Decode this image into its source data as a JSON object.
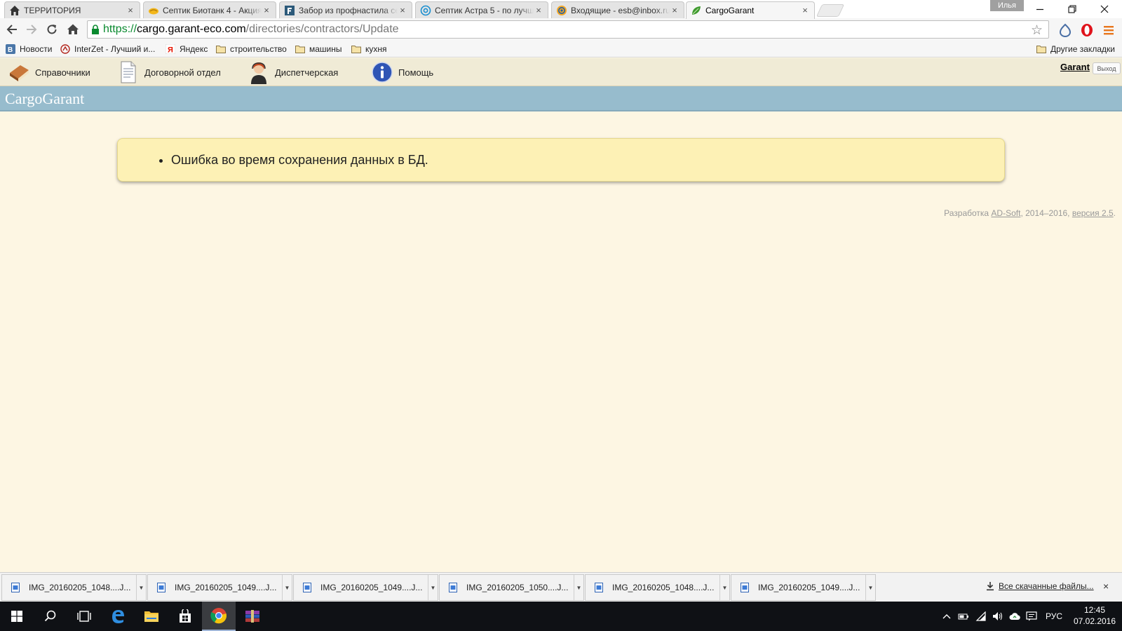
{
  "browser": {
    "tabs": [
      {
        "title": "ТЕРРИТОРИЯ",
        "icon": "home-icon",
        "close": "×"
      },
      {
        "title": "Септик Биотанк 4 - Акция",
        "icon": "handshake-icon",
        "close": "×"
      },
      {
        "title": "Забор из профнастила се",
        "icon": "f-logo-icon",
        "close": "×"
      },
      {
        "title": "Септик Астра 5 - по лучш",
        "icon": "at-icon",
        "close": "×"
      },
      {
        "title": "Входящие - esb@inbox.ru",
        "icon": "at-icon",
        "close": "×"
      },
      {
        "title": "CargoGarant",
        "icon": "leaf-icon",
        "close": "×"
      }
    ],
    "profile_name": "Илья",
    "address": {
      "scheme": "https://",
      "host": "cargo.garant-eco.com",
      "path": "/directories/contractors/Update"
    },
    "bookmarks": [
      {
        "label": "Новости",
        "icon": "vk-icon"
      },
      {
        "label": "InterZet - Лучший и...",
        "icon": "interzet-icon"
      },
      {
        "label": "Яндекс",
        "icon": "yandex-icon"
      },
      {
        "label": "строительство",
        "icon": "folder-icon"
      },
      {
        "label": "машины",
        "icon": "folder-icon"
      },
      {
        "label": "кухня",
        "icon": "folder-icon"
      }
    ],
    "other_bookmarks": "Другие закладки"
  },
  "app": {
    "menu": [
      {
        "label": "Справочники",
        "icon": "book-icon"
      },
      {
        "label": "Договорной отдел",
        "icon": "document-icon"
      },
      {
        "label": "Диспетчерская",
        "icon": "dispatcher-icon"
      },
      {
        "label": "Помощь",
        "icon": "info-icon"
      }
    ],
    "user": "Garant",
    "logout": "Выход",
    "brand": "CargoGarant"
  },
  "main": {
    "errors": [
      "Ошибка во время сохранения данных в БД."
    ],
    "footer": {
      "prefix": "Разработка ",
      "company": "AD-Soft",
      "years": ", 2014–2016, ",
      "version": "версия 2.5",
      "suffix": "."
    }
  },
  "downloads": {
    "items": [
      "IMG_20160205_1048....J...",
      "IMG_20160205_1049....J...",
      "IMG_20160205_1049....J...",
      "IMG_20160205_1050....J...",
      "IMG_20160205_1048....J...",
      "IMG_20160205_1049....J..."
    ],
    "all_label": "Все скачанные файлы...",
    "close": "×"
  },
  "taskbar": {
    "language": "РУС",
    "time": "12:45",
    "date": "07.02.2016"
  },
  "colors": {
    "brand_bar": "#97bccd",
    "menu_bar": "#f0ebd6",
    "content_bg": "#fdf6e3",
    "alert_bg": "#fdf1b5",
    "url_scheme": "#0a8a2f"
  }
}
